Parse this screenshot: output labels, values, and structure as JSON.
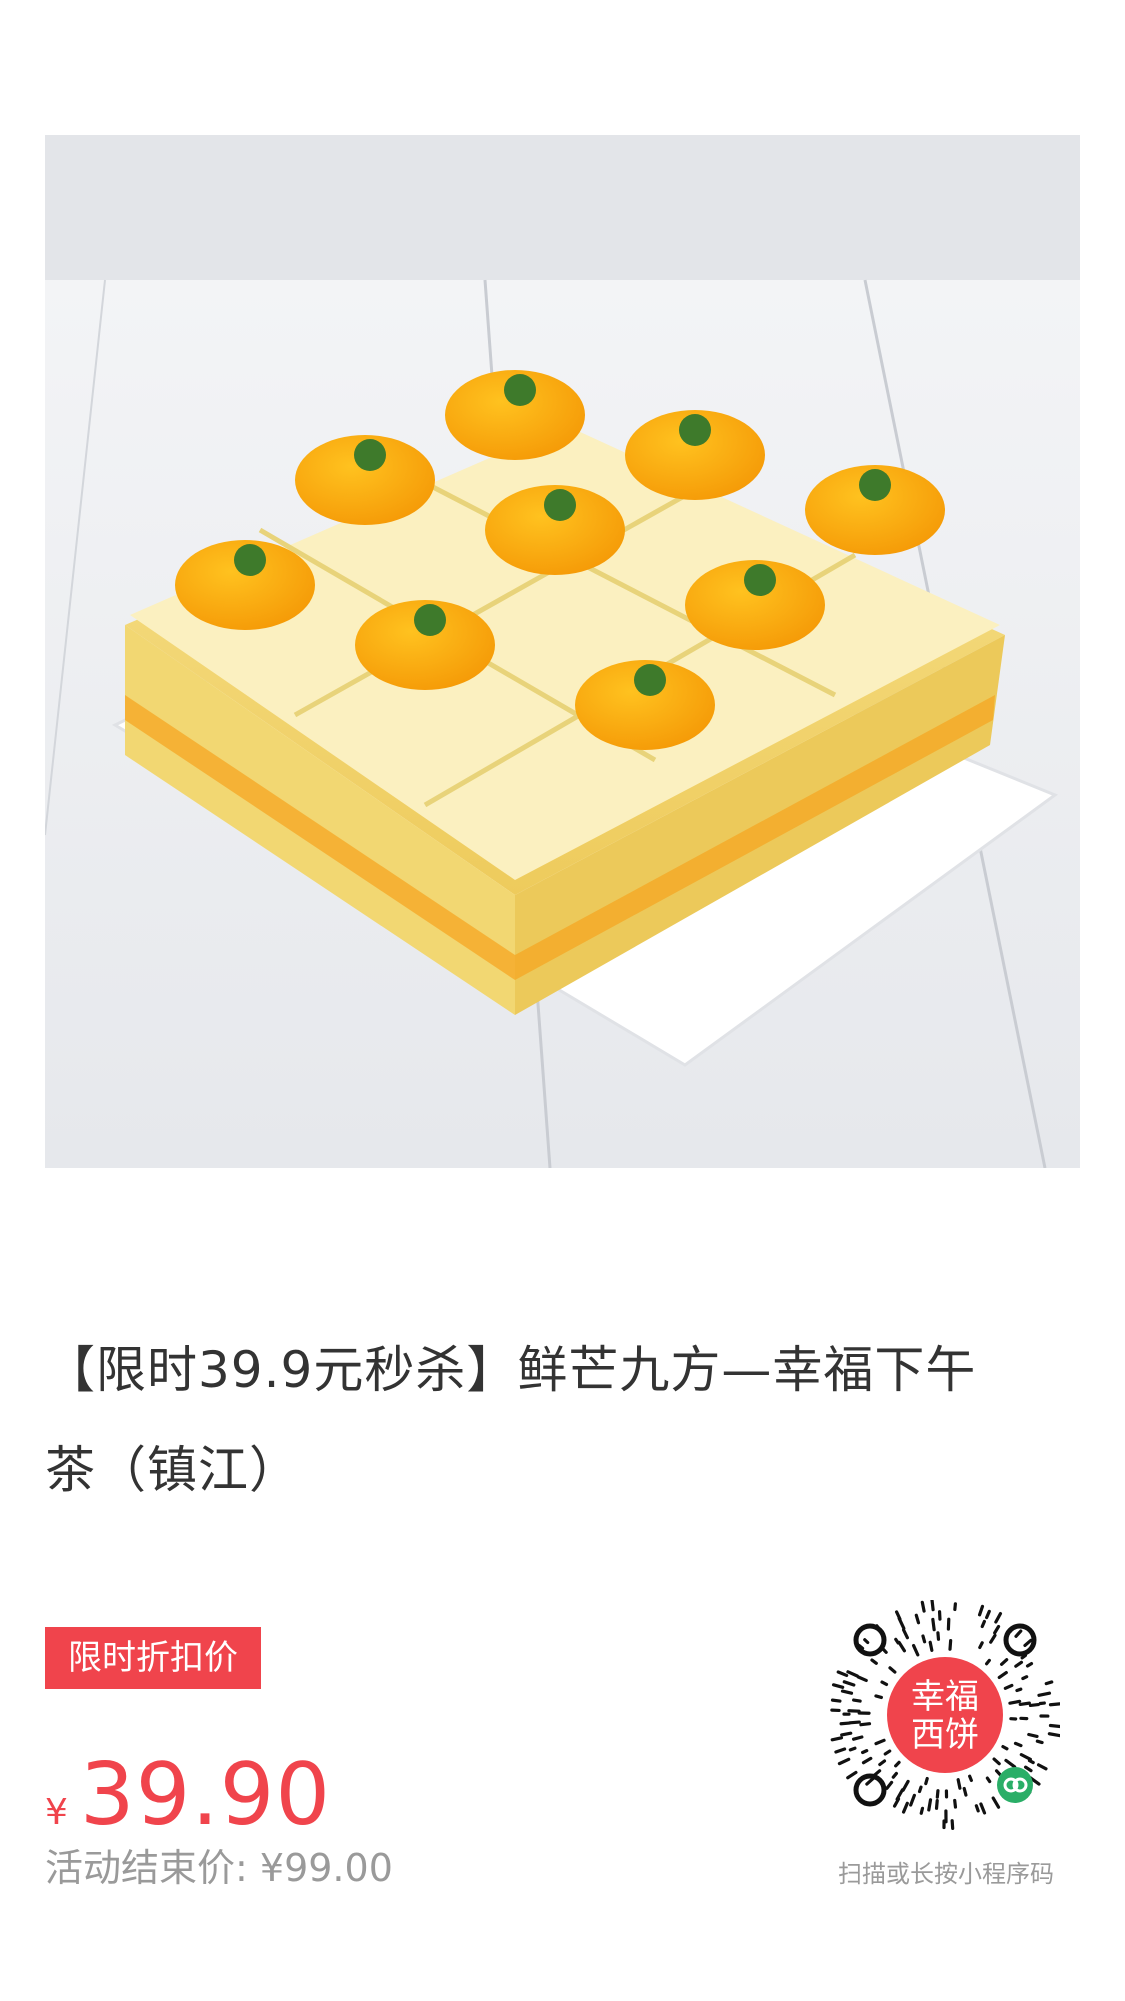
{
  "product": {
    "title": "【限时39.9元秒杀】鲜芒九方—幸福下午茶（镇江）",
    "image_alt": "鲜芒九方蛋糕"
  },
  "promo": {
    "badge": "限时折扣价",
    "currency": "¥",
    "price": "39.90",
    "original_label": "活动结束价:",
    "original_price": "¥99.00"
  },
  "mini_program": {
    "logo_line1": "幸福",
    "logo_line2": "西饼",
    "caption": "扫描或长按小程序码"
  },
  "colors": {
    "accent": "#f0444c",
    "muted": "#9a9a9a",
    "text": "#333333"
  }
}
